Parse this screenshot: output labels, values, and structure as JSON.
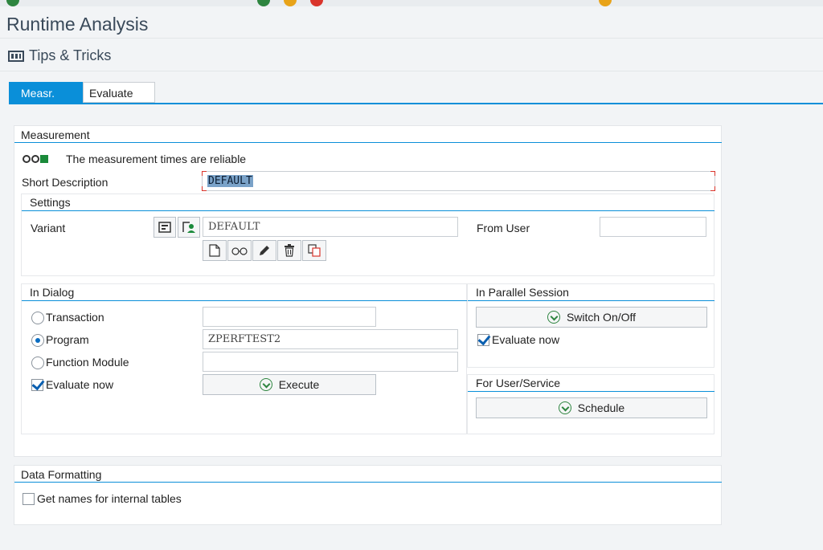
{
  "window": {
    "title": "Runtime Analysis"
  },
  "toolbar": {
    "tips_label": "Tips & Tricks"
  },
  "tabs": [
    {
      "label": "Measr.",
      "active": true
    },
    {
      "label": "Evaluate",
      "active": false
    }
  ],
  "measurement": {
    "heading": "Measurement",
    "status_text": "The measurement times are reliable",
    "short_description_label": "Short Description",
    "short_description_value": "DEFAULT",
    "settings": {
      "heading": "Settings",
      "variant_label": "Variant",
      "variant_value": "DEFAULT",
      "from_user_label": "From User",
      "from_user_value": ""
    },
    "in_dialog": {
      "heading": "In Dialog",
      "options": [
        {
          "label": "Transaction",
          "selected": false,
          "value": ""
        },
        {
          "label": "Program",
          "selected": true,
          "value": "ZPERFTEST2"
        },
        {
          "label": "Function Module",
          "selected": false,
          "value": ""
        }
      ],
      "evaluate_now_label": "Evaluate now",
      "evaluate_now_checked": true,
      "execute_label": "Execute"
    },
    "parallel": {
      "heading": "In Parallel Session",
      "switch_label": "Switch On/Off",
      "evaluate_now_label": "Evaluate now",
      "evaluate_now_checked": true
    },
    "user_service": {
      "heading": "For User/Service",
      "schedule_label": "Schedule"
    }
  },
  "data_formatting": {
    "heading": "Data Formatting",
    "get_names_label": "Get names for internal tables",
    "get_names_checked": false
  },
  "colors": {
    "accent": "#0a8fd9",
    "status_green": "#1a8a3a",
    "selection": "#7aa2c8"
  }
}
